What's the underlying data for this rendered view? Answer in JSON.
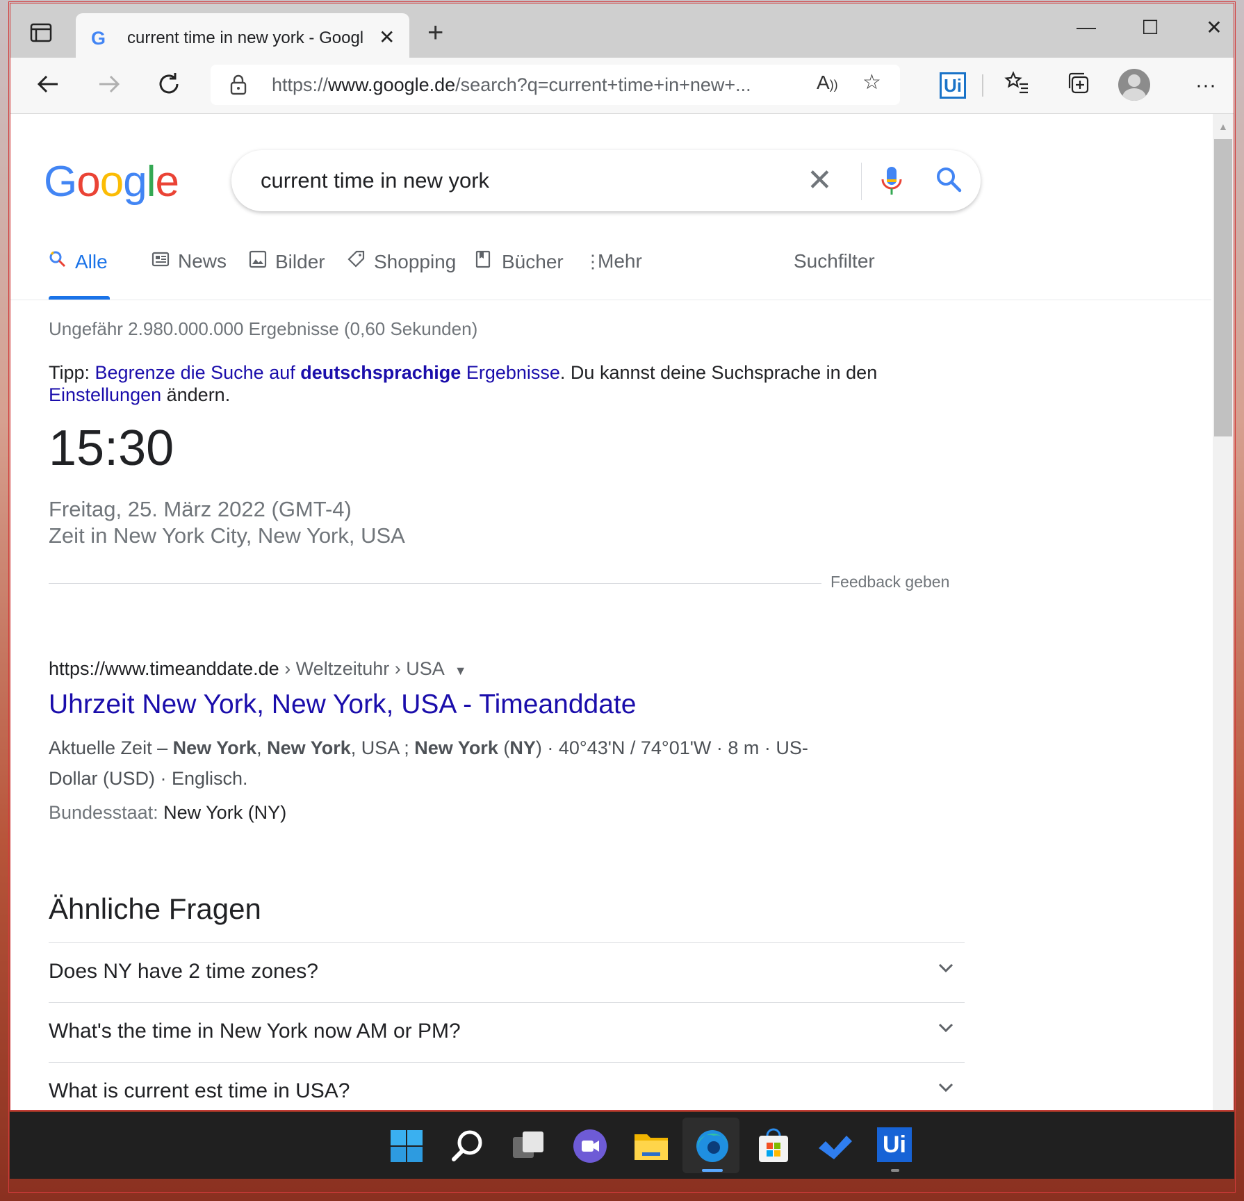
{
  "browser": {
    "tab_title": "current time in new york - Googl",
    "url_prefix": "https://",
    "url_domain": "www.google.de",
    "url_path": "/search?q=current+time+in+new+...",
    "extension_label": "Ui"
  },
  "google": {
    "logo": [
      "G",
      "o",
      "o",
      "g",
      "l",
      "e"
    ],
    "logo_colors": [
      "#4285f4",
      "#ea4335",
      "#fbbc05",
      "#4285f4",
      "#34a853",
      "#ea4335"
    ],
    "query": "current time in new york",
    "tabs": [
      {
        "label": "Alle",
        "icon": "search-icon"
      },
      {
        "label": "News",
        "icon": "news-icon"
      },
      {
        "label": "Bilder",
        "icon": "image-icon"
      },
      {
        "label": "Shopping",
        "icon": "tag-icon"
      },
      {
        "label": "Bücher",
        "icon": "book-icon"
      },
      {
        "label": "Mehr",
        "icon": "more-vert-icon"
      }
    ],
    "filter_label": "Suchfilter",
    "stats": "Ungefähr 2.980.000.000 Ergebnisse (0,60 Sekunden)",
    "tip": {
      "prefix": "Tipp: ",
      "link1a": "Begrenze die Suche auf ",
      "link1b": "deutschsprachige",
      "link1c": " Ergebnisse",
      "middle": ". Du kannst deine Suchsprache in den ",
      "link2": "Einstellungen",
      "suffix": " ändern."
    },
    "time": "15:30",
    "date": "Freitag, 25. März 2022 (GMT-4)",
    "location": "Zeit in New York City, New York, USA",
    "feedback": "Feedback geben",
    "result": {
      "cite_domain": "https://www.timeanddate.de",
      "cite_path": " › Weltzeituhr › USA",
      "title": "Uhrzeit New York, New York, USA - Timeanddate",
      "snippet_1": "Aktuelle Zeit – ",
      "snippet_b1": "New York",
      "snippet_2": ", ",
      "snippet_b2": "New York",
      "snippet_3": ", USA ; ",
      "snippet_b3": "New York",
      "snippet_4": " (",
      "snippet_b4": "NY",
      "snippet_5": ") · 40°43'N / 74°01'W · 8 m · US-Dollar (USD) · Englisch.",
      "attr_label": "Bundesstaat: ",
      "attr_value": "New York (NY)"
    },
    "paa_title": "Ähnliche Fragen",
    "paa": [
      "Does NY have 2 time zones?",
      "What's the time in New York now AM or PM?",
      "What is current est time in USA?"
    ]
  },
  "taskbar": {
    "icons": [
      "windows-start-icon",
      "search-icon",
      "task-view-icon",
      "teams-chat-icon",
      "file-explorer-icon",
      "edge-browser-icon",
      "microsoft-store-icon",
      "todo-icon",
      "uipath-icon"
    ],
    "uipath_label": "Ui"
  }
}
